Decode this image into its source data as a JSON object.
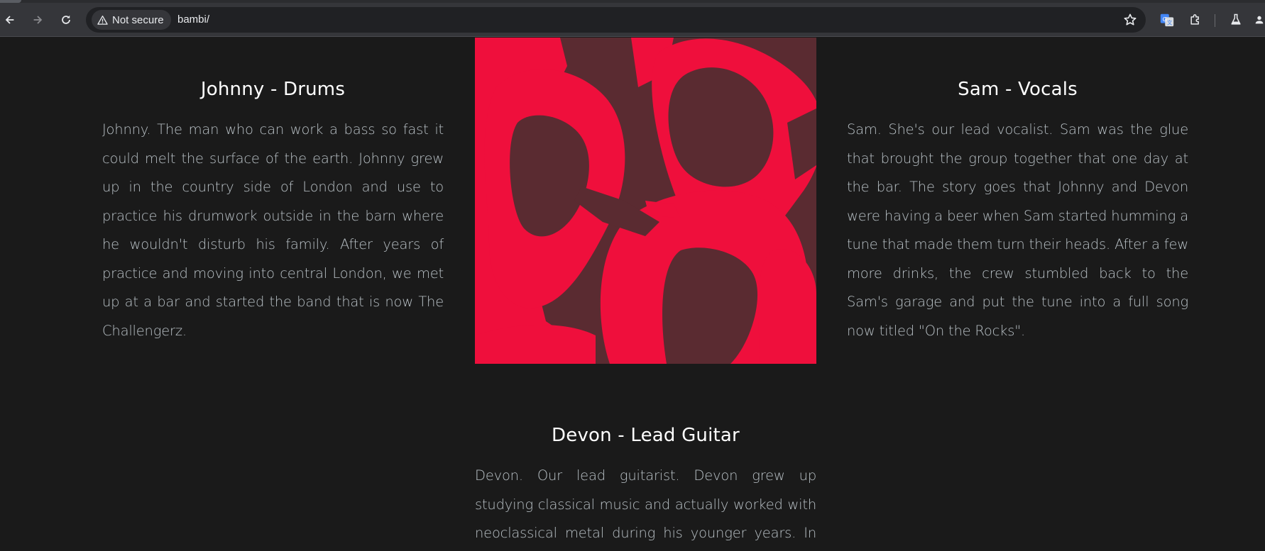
{
  "browser": {
    "security_label": "Not secure",
    "url": "bambi/",
    "icons": {
      "back": "back-arrow-icon",
      "forward": "forward-arrow-icon",
      "reload": "reload-icon",
      "security": "warning-triangle-icon",
      "bookmark": "star-icon",
      "translate": "translate-icon",
      "extensions": "puzzle-icon",
      "labs": "flask-icon",
      "profile": "profile-icon"
    }
  },
  "members": [
    {
      "name": "Johnny - Drums",
      "bio": "Johnny. The man who can work a bass so fast it could melt the surface of the earth. Johnny grew up in the country side of London and use to practice his drumwork outside in the barn where he wouldn't disturb his family. After years of practice and moving into central London, we met up at a bar and started the band that is now The Challengerz."
    },
    {
      "name": "Sam - Vocals",
      "bio": "Sam. She's our lead vocalist. Sam was the glue that brought the group together that one day at the bar. The story goes that Johnny and Devon were having a beer when Sam started humming a tune that made them turn their heads. After a few more drinks, the crew stumbled back to the Sam's garage and put the tune into a full song now titled \"On the Rocks\"."
    },
    {
      "name": "Devon - Lead Guitar",
      "bio": "Devon. Our lead guitarist. Devon grew up studying classical music and actually worked with neoclassical metal during his younger years. In today's time, he"
    }
  ],
  "colors": {
    "page_bg": "#1a1a1a",
    "heading": "#ffffff",
    "body_text": "#b9c1c6",
    "photo_red": "#ef0f3c",
    "photo_dark": "#5a2b31"
  }
}
